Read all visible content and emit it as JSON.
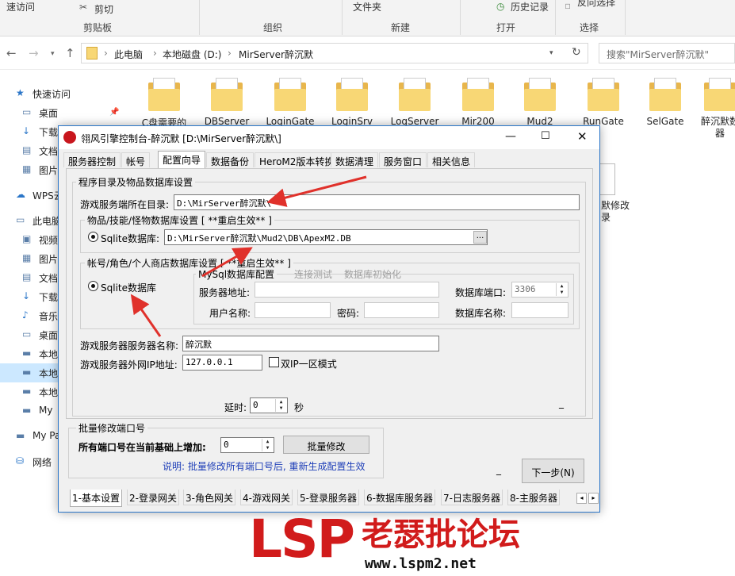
{
  "ribbon": {
    "recent": "速访问",
    "cut": "剪切",
    "folder": "文件夹",
    "history": "历史记录",
    "select_all": "反向选择",
    "groups": [
      "剪贴板",
      "组织",
      "新建",
      "打开",
      "选择"
    ]
  },
  "nav": {
    "crumbs": [
      "此电脑",
      "本地磁盘 (D:)",
      "MirServer醉沉默"
    ],
    "search_placeholder": "搜索\"MirServer醉沉默\""
  },
  "sidebar": {
    "items": [
      {
        "label": "快速访问",
        "icon": "star-icon"
      },
      {
        "label": "桌面",
        "icon": "desktop-icon"
      },
      {
        "label": "下载",
        "icon": "download-icon"
      },
      {
        "label": "文档",
        "icon": "document-icon"
      },
      {
        "label": "图片",
        "icon": "picture-icon"
      },
      {
        "label": "WPS云",
        "icon": "cloud-icon"
      },
      {
        "label": "此电脑",
        "icon": "computer-icon"
      },
      {
        "label": "视频",
        "icon": "video-icon"
      },
      {
        "label": "图片",
        "icon": "picture-icon"
      },
      {
        "label": "文档",
        "icon": "document-icon"
      },
      {
        "label": "下载",
        "icon": "download-icon"
      },
      {
        "label": "音乐",
        "icon": "music-icon"
      },
      {
        "label": "桌面",
        "icon": "desktop-icon"
      },
      {
        "label": "本地",
        "icon": "drive-icon"
      },
      {
        "label": "本地",
        "icon": "drive-icon"
      },
      {
        "label": "本地",
        "icon": "drive-icon"
      },
      {
        "label": "My",
        "icon": "drive-icon"
      },
      {
        "label": "My Pa",
        "icon": "drive-icon"
      },
      {
        "label": "网络",
        "icon": "network-icon"
      }
    ]
  },
  "files": [
    "C盘需要的",
    "DBServer",
    "LoginGate",
    "LoginSrv",
    "LogServer",
    "Mir200",
    "Mud2",
    "RunGate",
    "SelGate",
    "醉沉默数器"
  ],
  "file_extra": "默修改\n录",
  "dialog": {
    "title": "翎风引擎控制台-醉沉默 [D:\\MirServer醉沉默\\]",
    "top_tabs": [
      "服务器控制",
      "帐号",
      "配置向导",
      "数据备份",
      "HeroM2版本转换",
      "数据清理",
      "服务窗口",
      "相关信息"
    ],
    "group_main": "程序目录及物品数据库设置",
    "game_dir_label": "游戏服务端所在目录:",
    "game_dir_value": "D:\\MirServer醉沉默\\",
    "item_db_group": "物品/技能/怪物数据库设置 [ **重启生效** ]",
    "sqlite_label": "Sqlite数据库:",
    "sqlite_path": "D:\\MirServer醉沉默\\Mud2\\DB\\ApexM2.DB",
    "browse": "...",
    "account_db_group": "帐号/角色/个人商店数据库设置 [ **重启生效** ]",
    "sqlite_label2": "Sqlite数据库",
    "mysql_group": "MySql数据库配置",
    "test_conn": "连接测试",
    "db_init": "数据库初始化",
    "server_addr_label": "服务器地址:",
    "db_port_label": "数据库端口:",
    "db_port_value": "3306",
    "user_label": "用户名称:",
    "pwd_label": "密码:",
    "db_name_label": "数据库名称:",
    "server_name_label": "游戏服务器服务器名称:",
    "server_name_value": "醉沉默",
    "ext_ip_label": "游戏服务器外网IP地址:",
    "ext_ip_value": "127.0.0.1",
    "dual_ip_label": "双IP一区模式",
    "delay_label": "延时:",
    "delay_value": "0",
    "delay_unit": "秒",
    "dash1": "_",
    "batch_group": "批量修改端口号",
    "batch_label": "所有端口号在当前基础上增加:",
    "batch_value": "0",
    "batch_btn": "批量修改",
    "batch_note": "说明: 批量修改所有端口号后, 重新生成配置生效",
    "dash2": "_",
    "next_btn": "下一步(N)",
    "bottom_tabs": [
      "1-基本设置",
      "2-登录网关",
      "3-角色网关",
      "4-游戏网关",
      "5-登录服务器",
      "6-数据库服务器",
      "7-日志服务器",
      "8-主服务器"
    ]
  },
  "watermark": {
    "lsp": "LSP",
    "cn": "老瑟批论坛",
    "url": "www.lspm2.net"
  },
  "colors": {
    "accent": "#2b76c8",
    "arrow": "#e0312b",
    "folder": "#f8d775",
    "watermark": "#d11b1b"
  }
}
